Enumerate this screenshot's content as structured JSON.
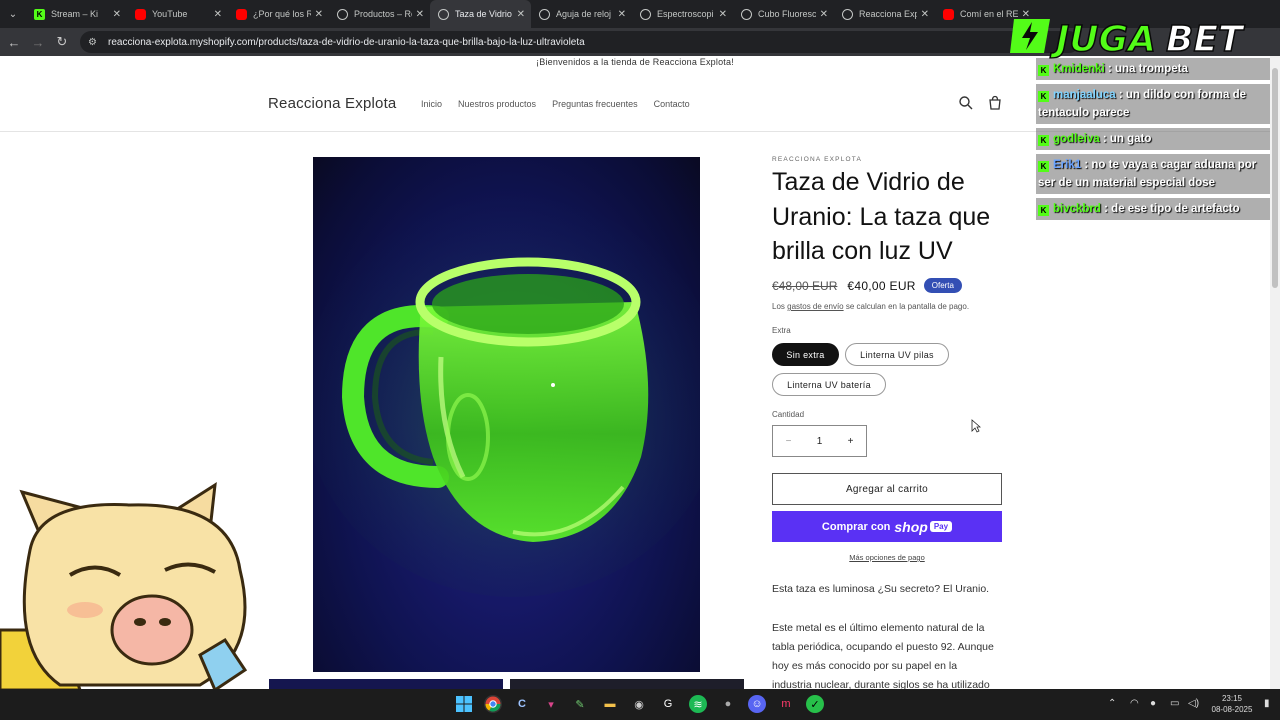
{
  "browser": {
    "tabs": [
      {
        "label": "Stream – Ki",
        "icon": "kick-icon"
      },
      {
        "label": "YouTube",
        "icon": "youtube-icon"
      },
      {
        "label": "¿Por qué los R",
        "icon": "youtube-icon"
      },
      {
        "label": "Productos – Re",
        "icon": "globe-icon"
      },
      {
        "label": "Taza de Vidrio",
        "icon": "globe-icon",
        "active": true
      },
      {
        "label": "Aguja de reloj",
        "icon": "globe-icon"
      },
      {
        "label": "Espectroscopi",
        "icon": "globe-icon"
      },
      {
        "label": "Cubo Fluoresc",
        "icon": "globe-icon"
      },
      {
        "label": "Reacciona Expl",
        "icon": "globe-icon"
      },
      {
        "label": "Comí en el RES",
        "icon": "youtube-icon"
      }
    ],
    "url": "reacciona-explota.myshopify.com/products/taza-de-vidrio-de-uranio-la-taza-que-brilla-bajo-la-luz-ultravioleta"
  },
  "store": {
    "announcement": "¡Bienvenidos a la tienda de Reacciona Explota!",
    "brand": "Reacciona Explota",
    "nav": [
      "Inicio",
      "Nuestros productos",
      "Preguntas frecuentes",
      "Contacto"
    ]
  },
  "product": {
    "vendor": "REACCIONA EXPLOTA",
    "title": "Taza de Vidrio de Uranio: La taza que brilla con luz UV",
    "price_old": "€48,00 EUR",
    "price_new": "€40,00 EUR",
    "badge": "Oferta",
    "ship_prefix": "Los ",
    "ship_link": "gastos de envío",
    "ship_suffix": " se calculan en la pantalla de pago.",
    "option_label": "Extra",
    "options": [
      "Sin extra",
      "Linterna UV pilas",
      "Linterna UV batería"
    ],
    "selected_option": "Sin extra",
    "qty_label": "Cantidad",
    "qty_value": "1",
    "add_to_cart": "Agregar al carrito",
    "buy_with": "Comprar con",
    "shop_word": "shop",
    "pay_word": "Pay",
    "more_options": "Más opciones de pago",
    "desc_intro": "Esta taza es luminosa ¿Su secreto? El Uranio.",
    "desc_p2_l1": "Este metal es el último elemento natural de la",
    "desc_p2_l2": "tabla periódica, ocupando el puesto 92. Aunque",
    "desc_p2_l3": "hoy es más conocido por su papel en la",
    "desc_p2_l4": "industria nuclear, durante siglos se ha utilizado"
  },
  "overlay": {
    "logo_text": "JUGABET",
    "chat": [
      {
        "user": "Kmidenki",
        "msg": ": una trompeta",
        "color": "green"
      },
      {
        "user": "manjaaluca",
        "msg": ": un dildo con forma de tentaculo parece",
        "color": "cyan"
      },
      {
        "user": "godleiva",
        "msg": ": un gato",
        "color": "green"
      },
      {
        "user": "Erik1",
        "msg": ": no te vaya a cagar aduana por ser de un material especial dose",
        "color": "blue"
      },
      {
        "user": "bivckbrd",
        "msg": ": de ese tipo de artefacto",
        "color": "green"
      }
    ]
  },
  "taskbar": {
    "time": "23:15",
    "date": "08-08-2025"
  },
  "colors": {
    "shop_pay": "#5a31f4",
    "badge": "#334fb4",
    "kick_green": "#53fc18",
    "glass_green": "#7dff3a"
  }
}
